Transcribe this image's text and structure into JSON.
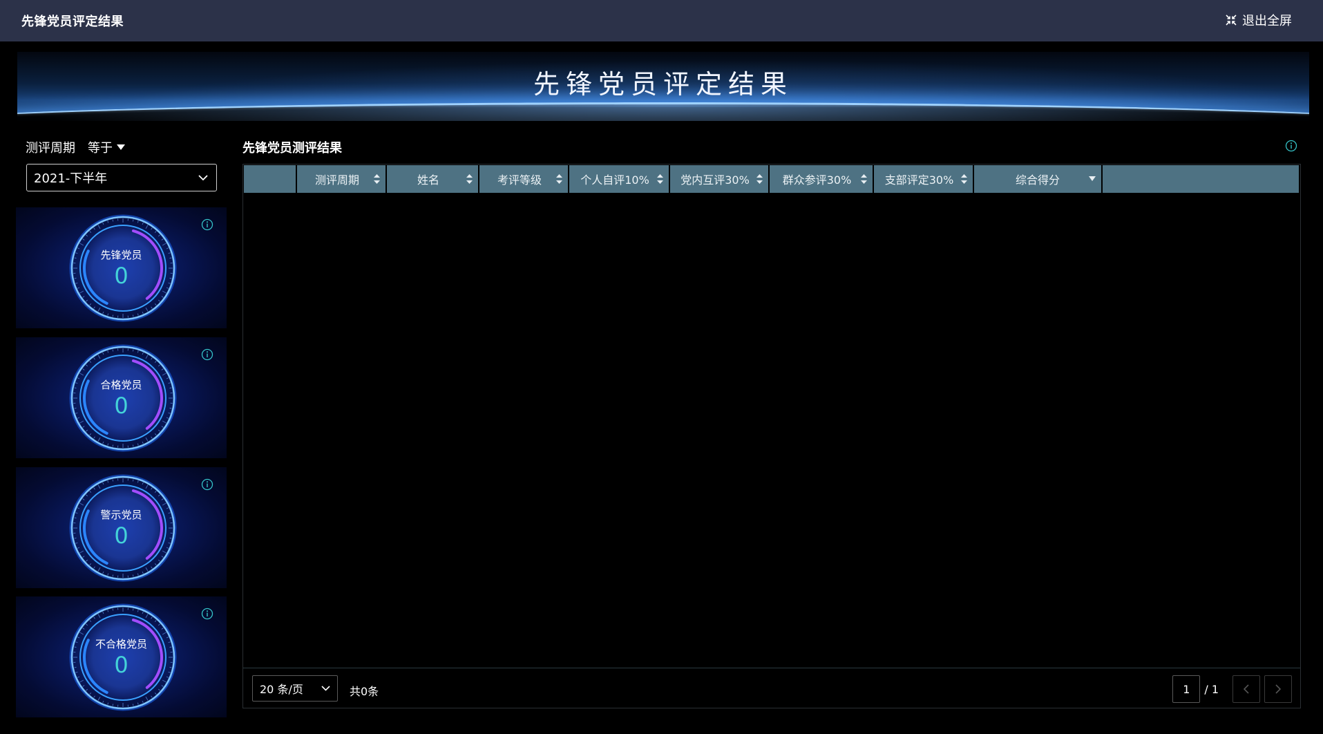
{
  "topbar": {
    "title": "先锋党员评定结果",
    "exit_label": "退出全屏"
  },
  "banner": {
    "heading": "先锋党员评定结果"
  },
  "filter": {
    "label": "测评周期",
    "operator": "等于",
    "selected": "2021-下半年"
  },
  "stats": [
    {
      "label": "先锋党员",
      "value": "0"
    },
    {
      "label": "合格党员",
      "value": "0"
    },
    {
      "label": "警示党员",
      "value": "0"
    },
    {
      "label": "不合格党员",
      "value": "0"
    }
  ],
  "table": {
    "title": "先锋党员测评结果",
    "columns": [
      "",
      "测评周期",
      "姓名",
      "考评等级",
      "个人自评10%",
      "党内互评30%",
      "群众参评30%",
      "支部评定30%",
      "综合得分",
      ""
    ],
    "rows": []
  },
  "pagination": {
    "page_size": "20 条/页",
    "total": "共0条",
    "current_page": "1",
    "total_pages": "/ 1"
  },
  "colors": {
    "topbar": "#2c3249",
    "header": "#4e7283",
    "stat_value": "#44d3d8",
    "info_icon": "#35c4c9"
  },
  "icons": {
    "exit": "collapse-arrows-icon",
    "info": "info-circle-icon",
    "sort": "sort-icon",
    "dropdown": "chevron-down-icon"
  }
}
